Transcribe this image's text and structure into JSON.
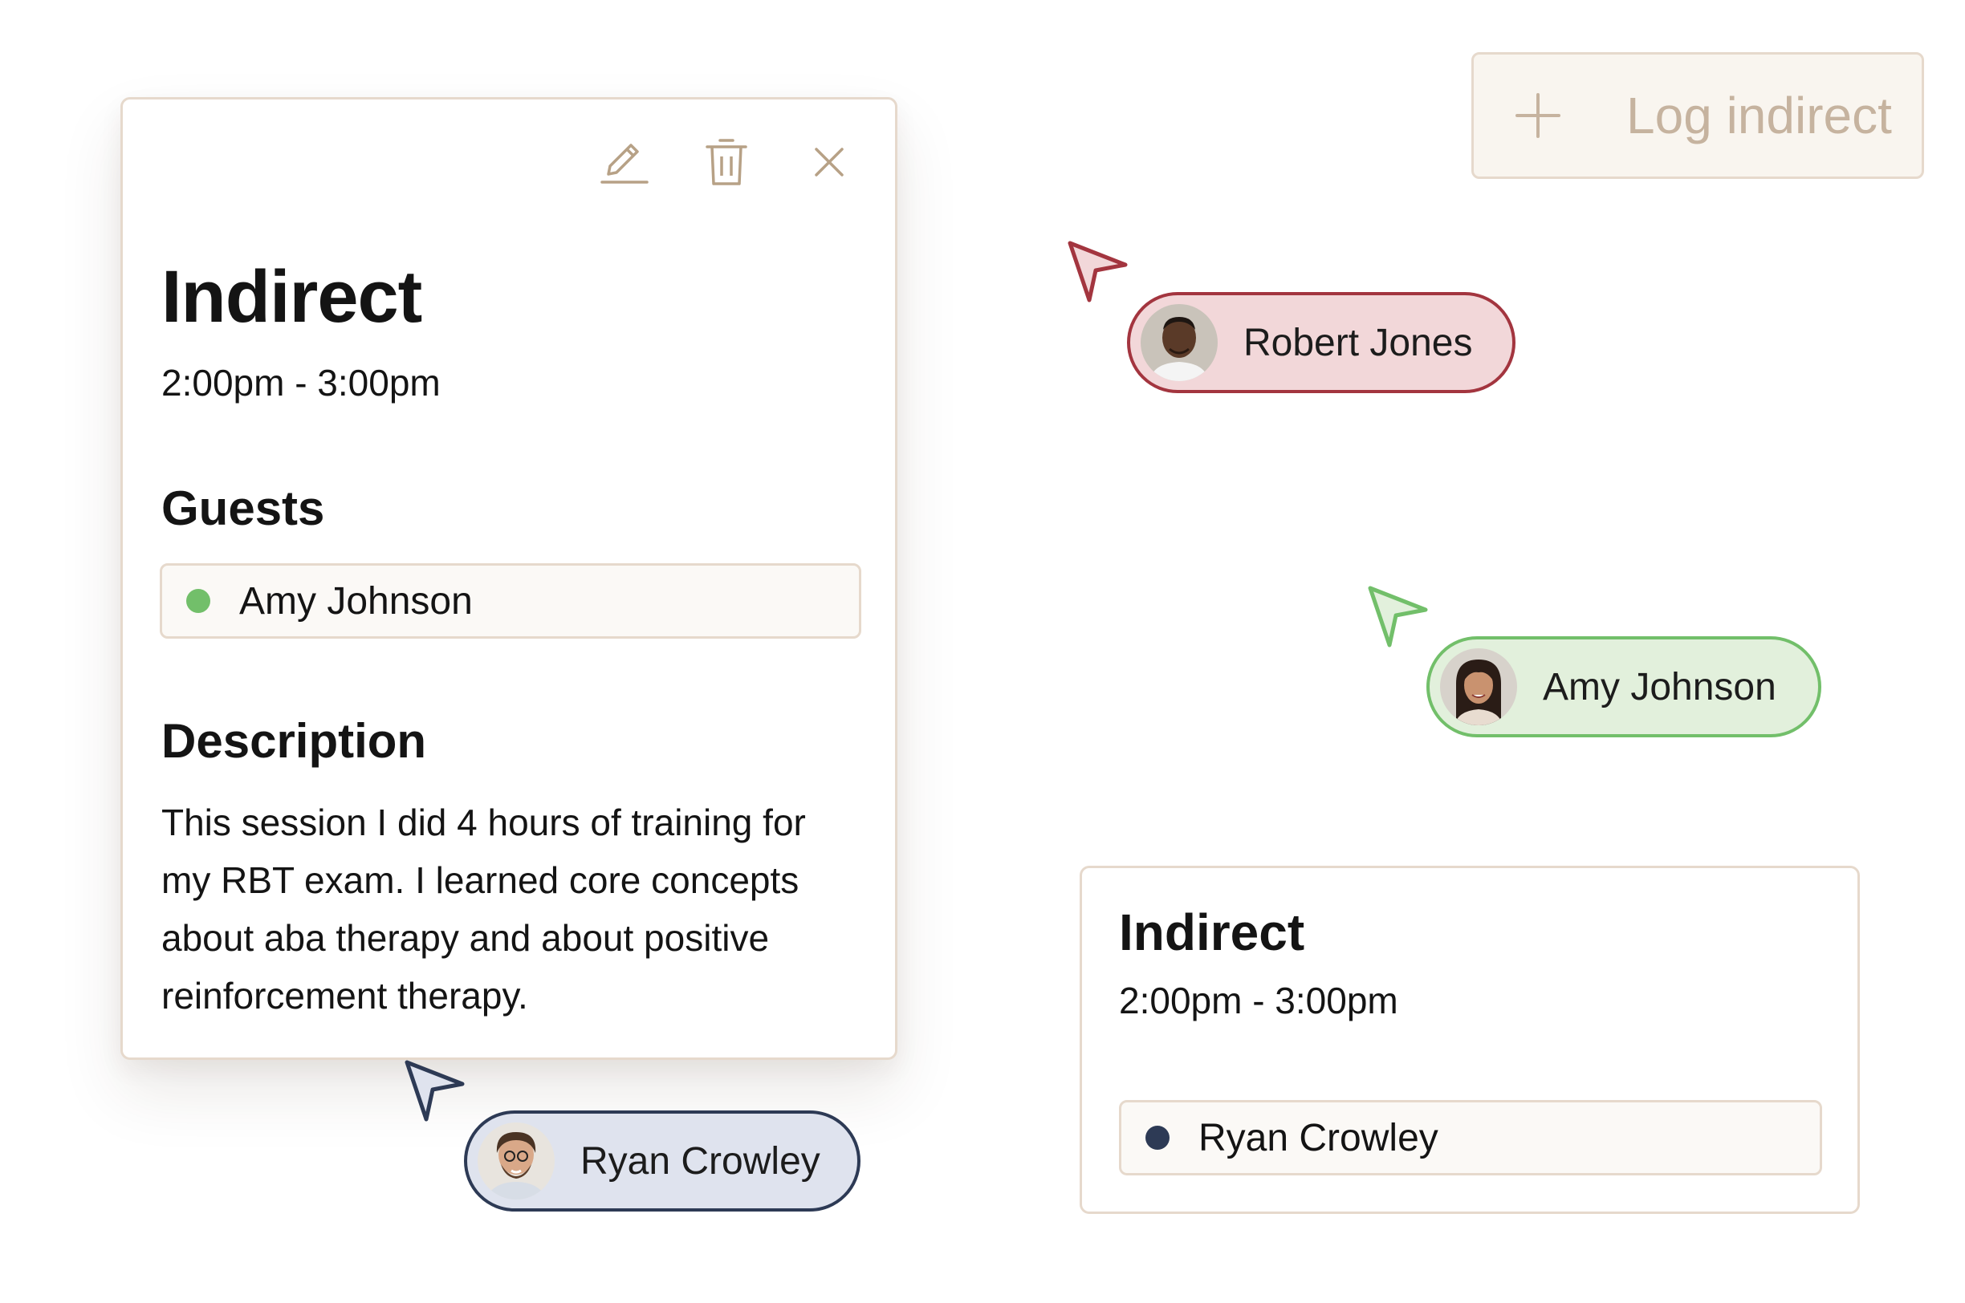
{
  "event_card": {
    "title": "Indirect",
    "time": "2:00pm - 3:00pm",
    "actions": {
      "edit_icon": "pencil-icon",
      "delete_icon": "trash-icon",
      "close_icon": "close-icon"
    },
    "guests_heading": "Guests",
    "guest": {
      "name": "Amy Johnson",
      "status_color": "#72bf6a"
    },
    "description_heading": "Description",
    "description": "This session I did 4 hours of training for my RBT exam. I learned core concepts about aba therapy and about positive reinforcement therapy."
  },
  "log_button": {
    "label": "Log indirect",
    "icon": "plus-icon"
  },
  "cursors": [
    {
      "name": "Robert Jones",
      "color": "#a3353f",
      "fill": "#f2d7d9"
    },
    {
      "name": "Amy Johnson",
      "color": "#72bf6a",
      "fill": "#e2f0dc"
    },
    {
      "name": "Ryan Crowley",
      "color": "#2d3a55",
      "fill": "#dfe3ee"
    }
  ],
  "mini_card": {
    "title": "Indirect",
    "time": "2:00pm - 3:00pm",
    "guest": {
      "name": "Ryan Crowley",
      "status_color": "#2d3a55"
    }
  }
}
